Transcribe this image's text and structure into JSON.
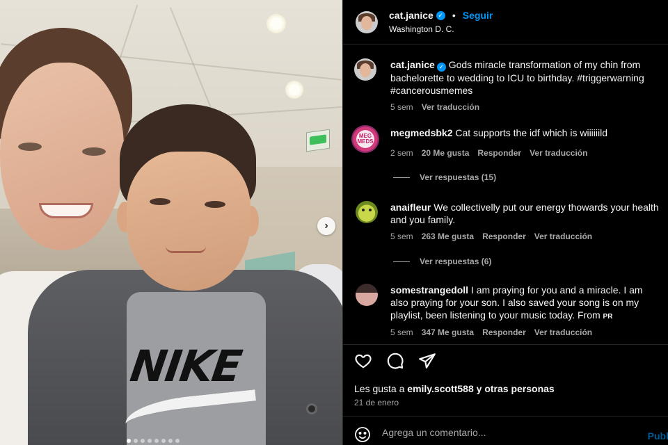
{
  "post": {
    "username": "cat.janice",
    "follow_label": "Seguir",
    "location": "Washington D. C.",
    "photo_overlay_text": "NIKE",
    "carousel_dots": 8,
    "carousel_active": 1
  },
  "caption": {
    "username": "cat.janice",
    "text": "Gods miracle transformation of my chin from bachelorette to wedding to ICU to birthday. #triggerwarning #cancerousmemes",
    "time": "5 sem",
    "translate": "Ver traducción"
  },
  "comments": [
    {
      "username": "megmedsbk2",
      "text": "Cat supports the idf which is wiiiiiild",
      "time": "2 sem",
      "likes": "20 Me gusta",
      "reply": "Responder",
      "translate": "Ver traducción",
      "replies": "Ver respuestas (15)",
      "avatar_text": "MEG MEDS"
    },
    {
      "username": "anaifleur",
      "text": "We collectivelly put our energy thowards your health and you family.",
      "time": "5 sem",
      "likes": "263 Me gusta",
      "reply": "Responder",
      "translate": "Ver traducción",
      "replies": "Ver respuestas (6)"
    },
    {
      "username": "somestrangedoll",
      "text": "I am praying for you and a miracle. I am also praying for your son. I also saved your song is on my playlist, been listening to your music today. From",
      "suffix": "PR",
      "time": "5 sem",
      "likes": "347 Me gusta",
      "reply": "Responder",
      "translate": "Ver traducción"
    }
  ],
  "likes_line": {
    "prefix": "Les gusta a",
    "user": "emily.scott588",
    "suffix": "y otras personas"
  },
  "date": "21 de enero",
  "composer": {
    "placeholder": "Agrega un comentario...",
    "publish": "Publ"
  },
  "colors": {
    "accent": "#0095f6",
    "secondary_text": "#a8a8a8",
    "background": "#000000"
  },
  "icons": [
    "verified-badge-icon",
    "chevron-right-icon",
    "heart-icon",
    "comment-icon",
    "share-icon",
    "emoji-icon"
  ]
}
